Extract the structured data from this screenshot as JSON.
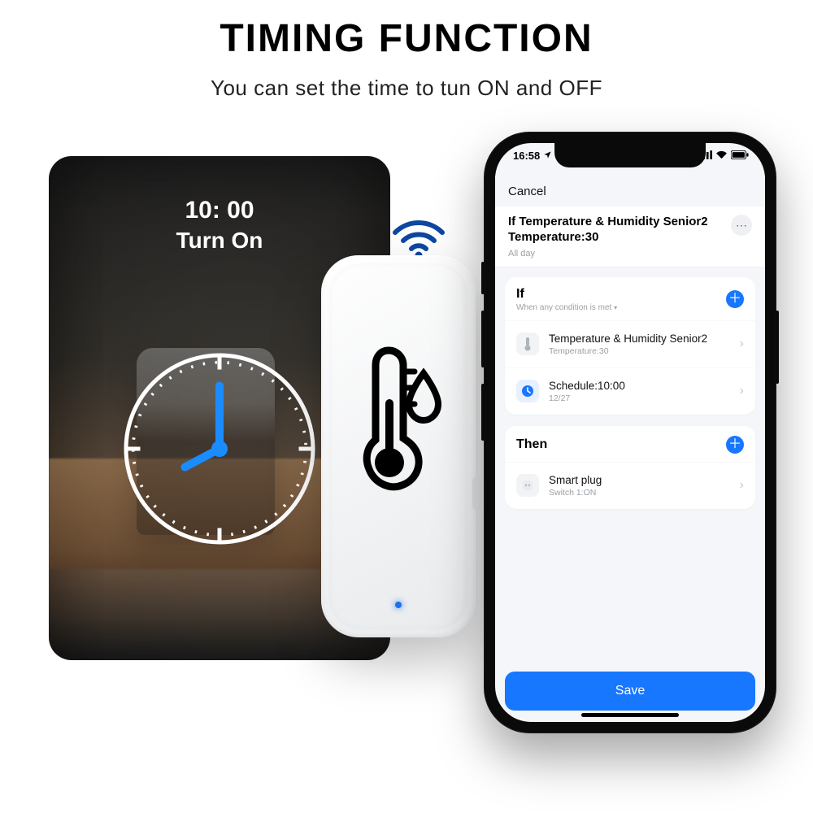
{
  "header": {
    "title": "TIMING FUNCTION",
    "subtitle": "You can set the time to tun ON and OFF"
  },
  "tile": {
    "time": "10: 00",
    "action": "Turn On"
  },
  "phone": {
    "status": {
      "time": "16:58"
    },
    "nav": {
      "cancel": "Cancel"
    },
    "automation": {
      "title": "If Temperature & Humidity Senior2 Temperature:30",
      "subtitle": "All day"
    },
    "if": {
      "section": "If",
      "condition": "When any condition is met",
      "rows": [
        {
          "line1": "Temperature & Humidity Senior2",
          "line2": "Temperature:30"
        },
        {
          "line1": "Schedule:10:00",
          "line2": "12/27"
        }
      ]
    },
    "then": {
      "section": "Then",
      "rows": [
        {
          "line1": "Smart plug",
          "line2": "Switch 1:ON"
        }
      ]
    },
    "save": "Save"
  },
  "colors": {
    "accent": "#1877ff"
  }
}
